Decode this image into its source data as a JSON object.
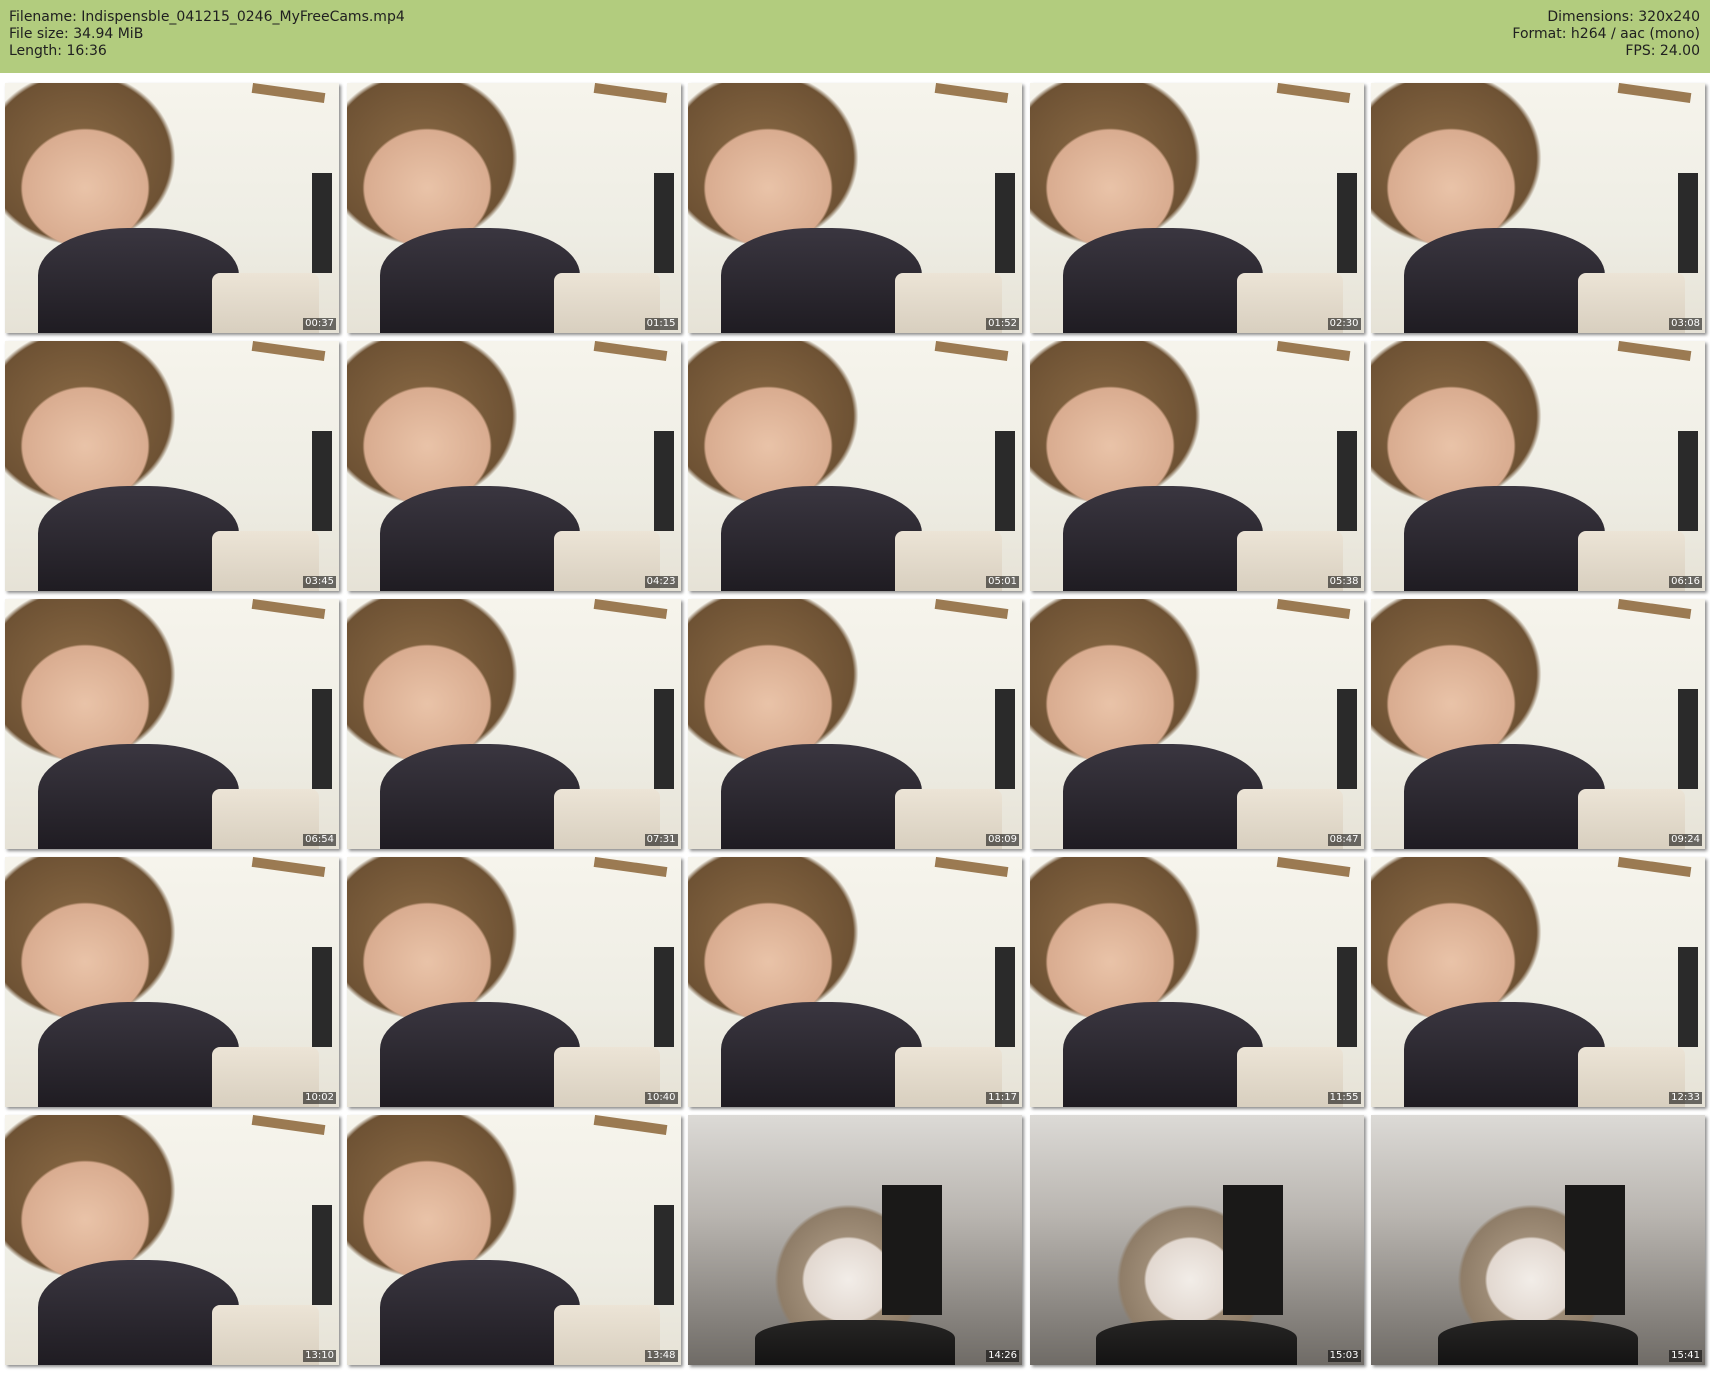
{
  "header": {
    "filename_line": "Filename: Indispensble_041215_0246_MyFreeCams.mp4",
    "filesize_line": "File size: 34.94 MiB",
    "length_line": "Length: 16:36",
    "dimensions_line": "Dimensions: 320x240",
    "format_line": "Format: h264 / aac (mono)",
    "fps_line": "FPS: 24.00",
    "background_color": "#b2cc7e"
  },
  "thumbnails": [
    {
      "time": "00:37",
      "scene": "a"
    },
    {
      "time": "01:15",
      "scene": "a"
    },
    {
      "time": "01:52",
      "scene": "a"
    },
    {
      "time": "02:30",
      "scene": "a"
    },
    {
      "time": "03:08",
      "scene": "a"
    },
    {
      "time": "03:45",
      "scene": "a"
    },
    {
      "time": "04:23",
      "scene": "a"
    },
    {
      "time": "05:01",
      "scene": "a"
    },
    {
      "time": "05:38",
      "scene": "a"
    },
    {
      "time": "06:16",
      "scene": "a"
    },
    {
      "time": "06:54",
      "scene": "a"
    },
    {
      "time": "07:31",
      "scene": "a"
    },
    {
      "time": "08:09",
      "scene": "a"
    },
    {
      "time": "08:47",
      "scene": "a"
    },
    {
      "time": "09:24",
      "scene": "a"
    },
    {
      "time": "10:02",
      "scene": "a"
    },
    {
      "time": "10:40",
      "scene": "a"
    },
    {
      "time": "11:17",
      "scene": "a"
    },
    {
      "time": "11:55",
      "scene": "a"
    },
    {
      "time": "12:33",
      "scene": "a"
    },
    {
      "time": "13:10",
      "scene": "a"
    },
    {
      "time": "13:48",
      "scene": "a"
    },
    {
      "time": "14:26",
      "scene": "b"
    },
    {
      "time": "15:03",
      "scene": "b"
    },
    {
      "time": "15:41",
      "scene": "b"
    }
  ]
}
